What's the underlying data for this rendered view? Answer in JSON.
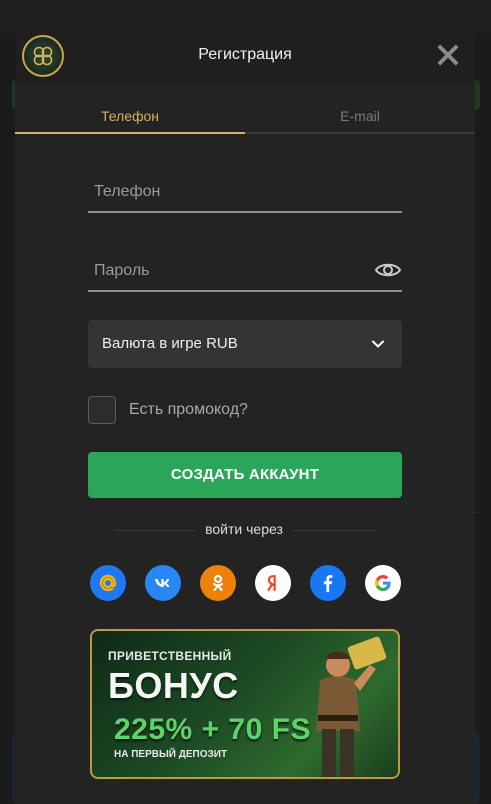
{
  "modal": {
    "title": "Регистрация",
    "close": "close"
  },
  "tabs": [
    {
      "label": "Телефон",
      "active": true
    },
    {
      "label": "E-mail",
      "active": false
    }
  ],
  "form": {
    "phone_placeholder": "Телефон",
    "password_placeholder": "Пароль",
    "currency_select": "Валюта в игре RUB",
    "promo_label": "Есть промокод?",
    "submit_label": "СОЗДАТЬ АККАУНТ"
  },
  "social": {
    "heading": "войти через",
    "providers": [
      "mail-ru",
      "vk",
      "odnoklassniki",
      "yandex",
      "facebook",
      "google"
    ]
  },
  "banner": {
    "line1": "ПРИВЕТСТВЕННЫЙ",
    "line2": "БОНУС",
    "offer": "225% + 70 FS",
    "sub": "НА ПЕРВЫЙ ДЕПОЗИТ"
  },
  "colors": {
    "accent": "#d8b25a",
    "primary_button": "#2aa55a",
    "modal_bg": "#232323"
  }
}
